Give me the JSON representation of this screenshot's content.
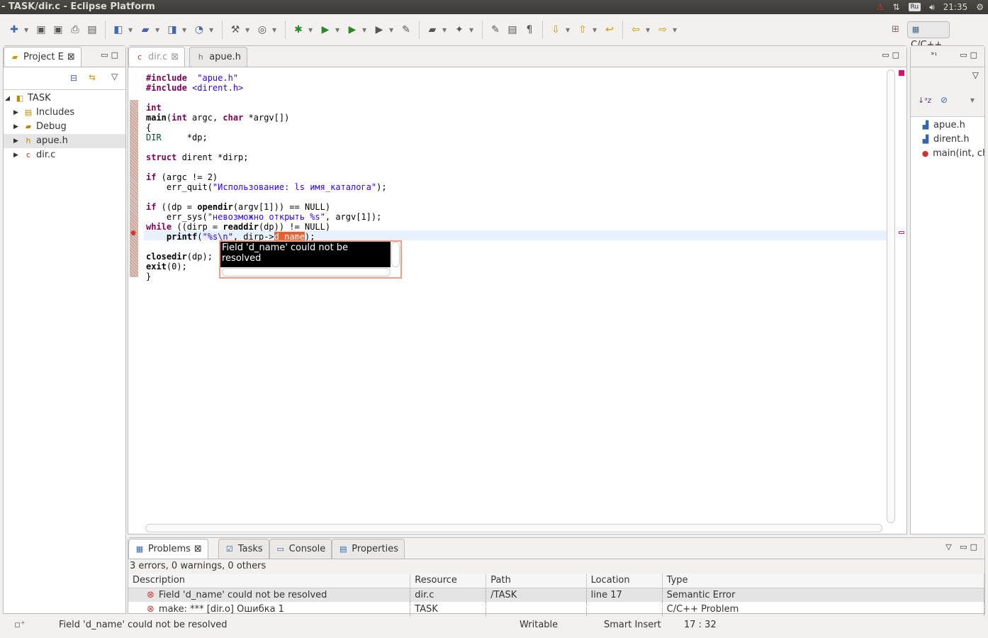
{
  "window": {
    "title": "- TASK/dir.c - Eclipse Platform"
  },
  "tray": {
    "keyboard": "Ru",
    "time": "21:35",
    "icons": [
      "warning-icon",
      "network-icon",
      "volume-icon",
      "power-icon"
    ]
  },
  "toolbar": {
    "icons": [
      "new-icon",
      "save-icon",
      "save-all-icon",
      "print-icon",
      "binary-icon",
      "new-cpp-project-icon",
      "new-folder-icon",
      "new-class-icon",
      "new-file-icon",
      "build-icon",
      "target-icon",
      "debug-icon",
      "run-icon",
      "run-history-icon",
      "external-tools-icon",
      "pin-icon",
      "open-type-icon",
      "search-icon",
      "highlight-icon",
      "block-icon",
      "whitespace-icon",
      "next-annotation-icon",
      "prev-annotation-icon",
      "last-edit-icon",
      "back-icon",
      "forward-icon"
    ],
    "perspective": "C/C++"
  },
  "project_explorer": {
    "tab": "Project E",
    "tree": [
      {
        "label": "TASK",
        "icon": "project-icon",
        "expanded": true
      },
      {
        "label": "Includes",
        "icon": "includes-icon"
      },
      {
        "label": "Debug",
        "icon": "folder-icon"
      },
      {
        "label": "apue.h",
        "icon": "header-file-icon",
        "selected": true
      },
      {
        "label": "dir.c",
        "icon": "c-file-error-icon"
      }
    ]
  },
  "editor": {
    "tabs": [
      {
        "label": "dir.c",
        "active": true
      },
      {
        "label": "apue.h"
      }
    ],
    "code": [
      [
        [
          "kw",
          "#include"
        ],
        [
          "",
          "  "
        ],
        [
          "str",
          "\"apue.h\""
        ]
      ],
      [
        [
          "kw",
          "#include"
        ],
        [
          "",
          ""
        ],
        [
          "str",
          " <dirent.h>"
        ]
      ],
      [],
      [
        [
          "kw",
          "int"
        ]
      ],
      [
        [
          "fn",
          "main"
        ],
        [
          "",
          "("
        ],
        [
          "kw",
          "int"
        ],
        [
          "",
          " argc, "
        ],
        [
          "kw",
          "char"
        ],
        [
          "",
          " *argv[])"
        ]
      ],
      [
        [
          "",
          "{"
        ]
      ],
      [
        [
          "ty",
          "DIR"
        ],
        [
          "",
          "     *dp;"
        ]
      ],
      [],
      [
        [
          "kw",
          "struct"
        ],
        [
          "",
          " dirent *dirp;"
        ]
      ],
      [],
      [
        [
          "kw",
          "if"
        ],
        [
          "",
          " (argc != 2)"
        ]
      ],
      [
        [
          "",
          "    err_quit("
        ],
        [
          "str",
          "\"Использование: ls имя_каталога\""
        ],
        [
          "",
          ");"
        ]
      ],
      [],
      [
        [
          "kw",
          "if"
        ],
        [
          "",
          " ((dp = "
        ],
        [
          "fn",
          "opendir"
        ],
        [
          "",
          "(argv[1])) == NULL)"
        ]
      ],
      [
        [
          "",
          "    err_sys("
        ],
        [
          "str",
          "\"невозможно открыть %s\""
        ],
        [
          "",
          ", argv[1]);"
        ]
      ],
      [
        [
          "kw",
          "while"
        ],
        [
          "",
          " ((dirp = "
        ],
        [
          "fn",
          "readdir"
        ],
        [
          "",
          "(dp)) != NULL)"
        ]
      ],
      [
        [
          "",
          "    "
        ],
        [
          "fn",
          "printf"
        ],
        [
          "",
          "("
        ],
        [
          "str",
          "\"%s\\n\""
        ],
        [
          "",
          ", dirp->"
        ],
        [
          "err",
          "d_name"
        ],
        [
          "",
          ");"
        ]
      ],
      [],
      [
        [
          "fn",
          "closedir"
        ],
        [
          "",
          "(dp);"
        ]
      ],
      [
        [
          "fn",
          "exit"
        ],
        [
          "",
          "(0);"
        ]
      ],
      [
        [
          "",
          "}"
        ]
      ]
    ],
    "hover": "Field 'd_name' could not be resolved"
  },
  "outline": {
    "items": [
      {
        "label": "apue.h",
        "icon": "include-icon"
      },
      {
        "label": "dirent.h",
        "icon": "include-icon"
      },
      {
        "label": "main(int, ch",
        "icon": "function-error-icon"
      }
    ]
  },
  "problems": {
    "tabs": [
      "Problems",
      "Tasks",
      "Console",
      "Properties"
    ],
    "summary": "3 errors, 0 warnings, 0 others",
    "columns": [
      "Description",
      "Resource",
      "Path",
      "Location",
      "Type"
    ],
    "rows": [
      [
        "Field 'd_name' could not be resolved",
        "dir.c",
        "/TASK",
        "line 17",
        "Semantic Error"
      ],
      [
        "make: *** [dir.o] Ошибка 1",
        "TASK",
        "",
        "",
        "C/C++ Problem"
      ]
    ]
  },
  "status": {
    "message": "Field 'd_name' could not be resolved",
    "writable": "Writable",
    "insert": "Smart Insert",
    "position": "17 : 32"
  }
}
